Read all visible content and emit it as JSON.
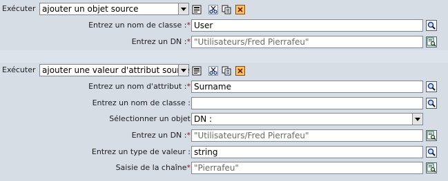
{
  "section1": {
    "execute_label": "Exécuter",
    "action_value": "ajouter un objet source",
    "class_name_label": "Entrez un nom de classe :",
    "class_name_value": "User",
    "dn_label": "Entrez un DN :",
    "dn_value": "\"Utilisateurs/Fred Pierrafeu\""
  },
  "section2": {
    "execute_label": "Exécuter",
    "action_value": "ajouter une valeur d'attribut source",
    "attribute_name_label": "Entrez un nom d'attribut :",
    "attribute_name_value": "Surname",
    "class_name_label": "Entrez un nom de classe :",
    "class_name_value": "",
    "select_object_label": "Sélectionner un objet",
    "select_object_value": "DN :",
    "dn_label": "Entrez un DN :",
    "dn_value": "\"Utilisateurs/Fred Pierrafeu\"",
    "value_type_label": "Entrez un type de valeur :",
    "value_type_value": "string",
    "string_entry_label": "Saisie de la chaîne",
    "string_entry_value": "\"Pierrafeu\""
  },
  "required_marker": "*",
  "icons": {
    "browse": "magnifier-icon",
    "argument_builder": "argument-builder-icon",
    "toolbar": [
      "edit-icon",
      "cut-icon",
      "copy-icon",
      "delete-icon"
    ]
  },
  "colors": {
    "background": "#d6dde5",
    "required": "#c00000",
    "hint_text": "#6b6b6b"
  }
}
